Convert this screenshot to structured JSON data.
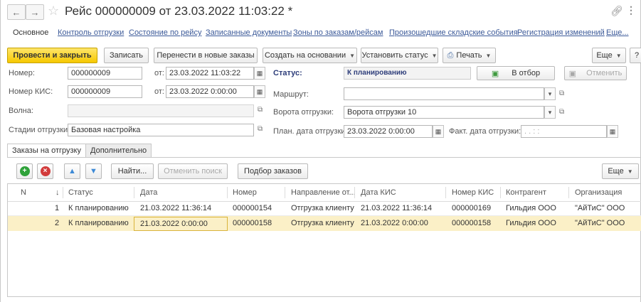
{
  "window": {
    "title": "Рейс 000000009 от 23.03.2022 11:03:22 *",
    "back_icon": "arrow-left-icon",
    "forward_icon": "arrow-right-icon",
    "star_icon": "star-icon",
    "link_icon": "link-icon",
    "menu_icon": "more-vertical-icon"
  },
  "nav_tabs": [
    {
      "label": "Основное"
    },
    {
      "label": "Контроль отгрузки"
    },
    {
      "label": "Состояние по рейсу"
    },
    {
      "label": "Записанные документы"
    },
    {
      "label": "Зоны по заказам/рейсам"
    },
    {
      "label": "Произошедшие складские события"
    },
    {
      "label": "Регистрация изменений"
    },
    {
      "label": "Еще..."
    }
  ],
  "toolbar": {
    "post_close": "Провести и закрыть",
    "save": "Записать",
    "move_orders": "Перенести в новые заказы",
    "create_based": "Создать на основании",
    "set_status": "Установить статус",
    "print": "Печать",
    "more": "Еще",
    "help": "?"
  },
  "form": {
    "number_label": "Номер:",
    "number_value": "000000009",
    "from_label": "от:",
    "date_value": "23.03.2022 11:03:22",
    "kis_label": "Номер КИС:",
    "kis_value": "000000009",
    "kis_from_label": "от:",
    "kis_date_value": "23.03.2022  0:00:00",
    "wave_label": "Волна:",
    "wave_value": "",
    "stages_label": "Стадии отгрузки:",
    "stages_value": "Базовая настройка",
    "status_label": "Статус:",
    "status_value": "К планированию",
    "to_selection": "В отбор",
    "cancel": "Отменить",
    "route_label": "Маршрут:",
    "route_value": "",
    "gate_label": "Ворота отгрузки:",
    "gate_value": "Ворота отгрузки 10",
    "plan_date_label": "План. дата отгрузки:",
    "plan_date_value": "23.03.2022  0:00:00",
    "fact_date_label": "Факт. дата отгрузки:",
    "fact_date_value": " .  .      :  :"
  },
  "inner_tabs": [
    {
      "label": "Заказы на отгрузку"
    },
    {
      "label": "Дополнительно"
    }
  ],
  "table_toolbar": {
    "find": "Найти...",
    "cancel_search": "Отменить поиск",
    "select_orders": "Подбор заказов",
    "more": "Еще"
  },
  "table": {
    "columns": [
      "N",
      "↓",
      "Статус",
      "Дата",
      "Номер",
      "Направление от...",
      "Дата КИС",
      "Номер КИС",
      "Контрагент",
      "Организация"
    ],
    "rows": [
      [
        "1",
        "К планированию",
        "21.03.2022 11:36:14",
        "000000154",
        "Отгрузка клиенту",
        "21.03.2022 11:36:14",
        "000000169",
        "Гильдия ООО",
        "\"АйТиС\" ООО"
      ],
      [
        "2",
        "К планированию",
        "21.03.2022 0:00:00",
        "000000158",
        "Отгрузка клиенту",
        "21.03.2022 0:00:00",
        "000000158",
        "Гильдия ООО",
        "\"АйТиС\" ООО"
      ]
    ]
  },
  "colors": {
    "primary_button": "#f6c800",
    "link": "#3c5a99",
    "selected_row": "#fbf0c7",
    "add_icon": "#2fa23a",
    "delete_icon": "#d23b3b",
    "move_icon": "#3d8ad6"
  }
}
